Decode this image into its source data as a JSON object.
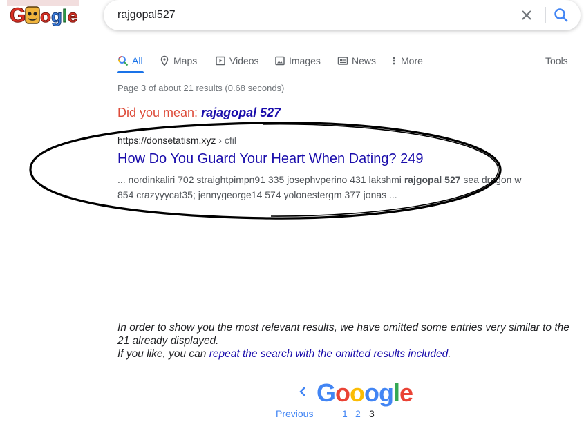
{
  "header": {
    "logo_alt": "Google",
    "search": {
      "value": "rajgopal527"
    }
  },
  "tabs": [
    {
      "label": "All",
      "icon": "search-icon",
      "active": true
    },
    {
      "label": "Maps",
      "icon": "map-pin-icon"
    },
    {
      "label": "Videos",
      "icon": "video-icon"
    },
    {
      "label": "Images",
      "icon": "image-icon"
    },
    {
      "label": "News",
      "icon": "news-icon"
    },
    {
      "label": "More",
      "icon": "more-vert-icon"
    }
  ],
  "tools_label": "Tools",
  "result_stats": "Page 3 of about 21 results (0.68 seconds)",
  "did_you_mean": {
    "prefix": "Did you mean:",
    "suggestion": "rajagopal 527"
  },
  "result": {
    "url": "https://donsetatism.xyz",
    "breadcrumb": "› cfil",
    "title": "How Do You Guard Your Heart When Dating? 249",
    "snippet_before": "... nordinkaliri 702 straightpimpn91 335 josephvperino 431 lakshmi ",
    "snippet_bold": "rajgopal 527",
    "snippet_after": " sea dragon w 854 crazyyycat35; jennygeorge14 574 yolonestergm 377 jonas ..."
  },
  "omitted": {
    "line1": "In order to show you the most relevant results, we have omitted some entries very similar to the 21 already displayed.",
    "line2_prefix": "If you like, you can ",
    "line2_link": "repeat the search with the omitted results included",
    "line2_suffix": "."
  },
  "pagination": {
    "logo_letters": [
      "G",
      "o",
      "o",
      "o",
      "g",
      "l",
      "e"
    ],
    "logo_colors": [
      "#4285f4",
      "#ea4335",
      "#fbbc05",
      "#4285f4",
      "#4285f4",
      "#34a853",
      "#ea4335"
    ],
    "previous_label": "Previous",
    "pages": [
      "1",
      "2",
      "3"
    ],
    "current_page": "3"
  },
  "colors": {
    "accent": "#1a73e8",
    "link": "#1a0dab",
    "did_you_mean": "#dd4b39",
    "annotation": "#000000"
  }
}
